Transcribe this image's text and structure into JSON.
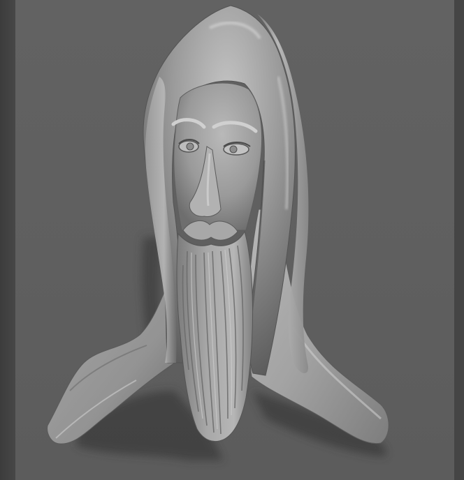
{
  "scene": {
    "subject": "relief-sculpture-hooded-bearded-figure",
    "colors": {
      "background": "#606060",
      "surround": "#363636",
      "clay_highlight": "#cfcfcf",
      "clay_mid": "#8e8e8e",
      "clay_shadow": "#3e3e3e",
      "cast_shadow": "#404040"
    }
  }
}
